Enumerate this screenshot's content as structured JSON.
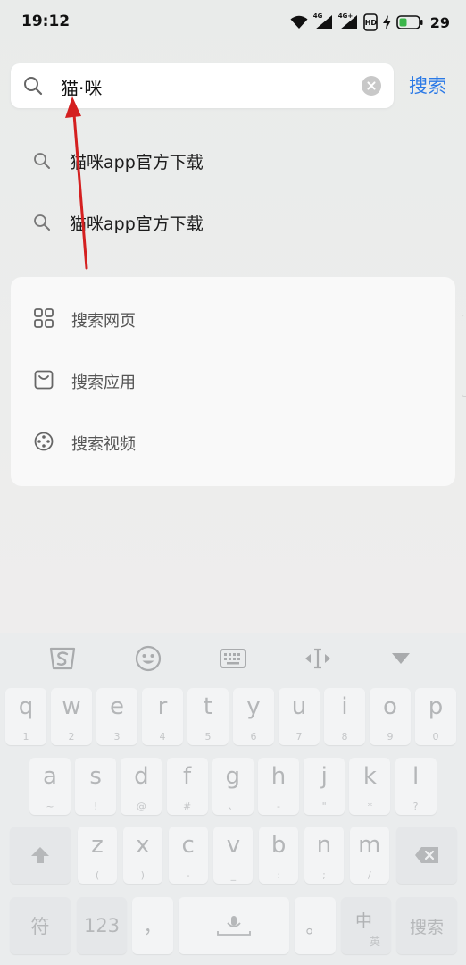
{
  "status_bar": {
    "time": "19:12",
    "network_1": "4G",
    "network_2": "4G+",
    "hd_label": "HD",
    "battery": "29"
  },
  "search": {
    "query": "猫·咪",
    "action_label": "搜索"
  },
  "suggestions": [
    {
      "text": "猫咪app官方下载"
    },
    {
      "text": "猫咪app官方下载"
    }
  ],
  "search_options": [
    {
      "label": "搜索网页",
      "icon": "grid-icon"
    },
    {
      "label": "搜索应用",
      "icon": "app-bag-icon"
    },
    {
      "label": "搜索视频",
      "icon": "film-reel-icon"
    }
  ],
  "keyboard": {
    "toolbar": [
      "sogou-logo-icon",
      "emoji-icon",
      "keyboard-icon",
      "cursor-move-icon",
      "collapse-icon"
    ],
    "row1": [
      {
        "k": "q",
        "s": "1"
      },
      {
        "k": "w",
        "s": "2"
      },
      {
        "k": "e",
        "s": "3"
      },
      {
        "k": "r",
        "s": "4"
      },
      {
        "k": "t",
        "s": "5"
      },
      {
        "k": "y",
        "s": "6"
      },
      {
        "k": "u",
        "s": "7"
      },
      {
        "k": "i",
        "s": "8"
      },
      {
        "k": "o",
        "s": "9"
      },
      {
        "k": "p",
        "s": "0"
      }
    ],
    "row2": [
      {
        "k": "a",
        "s": "~"
      },
      {
        "k": "s",
        "s": "!"
      },
      {
        "k": "d",
        "s": "@"
      },
      {
        "k": "f",
        "s": "#"
      },
      {
        "k": "g",
        "s": "、"
      },
      {
        "k": "h",
        "s": "-"
      },
      {
        "k": "j",
        "s": "\""
      },
      {
        "k": "k",
        "s": "*"
      },
      {
        "k": "l",
        "s": "?"
      }
    ],
    "row3": [
      {
        "k": "z",
        "s": "("
      },
      {
        "k": "x",
        "s": ")"
      },
      {
        "k": "c",
        "s": "-"
      },
      {
        "k": "v",
        "s": "_"
      },
      {
        "k": "b",
        "s": ":"
      },
      {
        "k": "n",
        "s": ";"
      },
      {
        "k": "m",
        "s": "/"
      }
    ],
    "symbol_key": "符",
    "num_key": "123",
    "comma_key": "，",
    "period_key": "。",
    "lang_key_main": "中",
    "lang_key_sub": "英",
    "search_key": "搜索"
  },
  "colors": {
    "accent": "#2a79e6",
    "annotation_arrow": "#d42020"
  }
}
